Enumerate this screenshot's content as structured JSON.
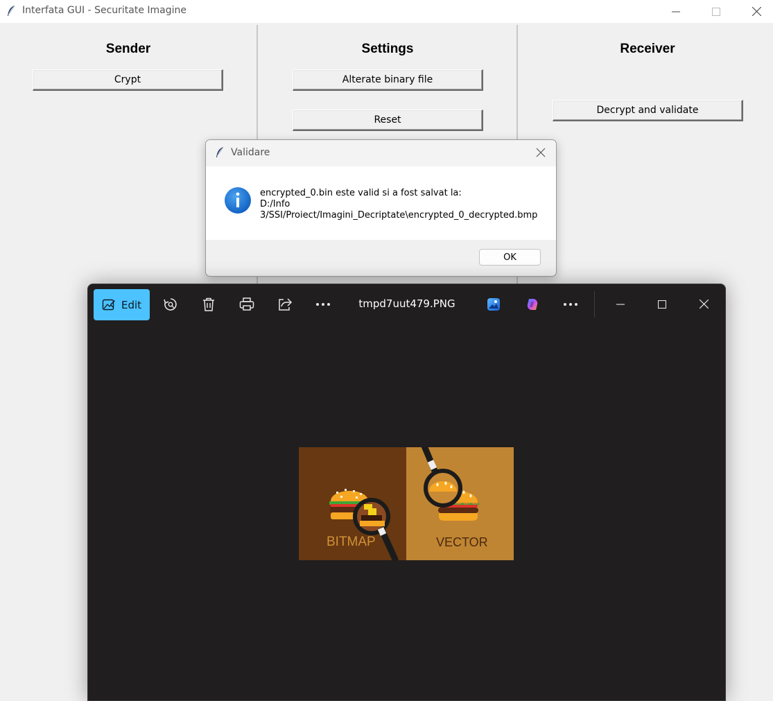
{
  "window": {
    "title": "Interfata GUI - Securitate Imagine"
  },
  "sender": {
    "title": "Sender",
    "crypt_label": "Crypt"
  },
  "settings": {
    "title": "Settings",
    "alterate_label": "Alterate binary file",
    "reset_label": "Reset"
  },
  "receiver": {
    "title": "Receiver",
    "decrypt_label": "Decrypt and validate"
  },
  "dialog": {
    "title": "Validare",
    "line1": "encrypted_0.bin este valid si a fost salvat la:",
    "line2": "D:/Info",
    "line3": "3/SSI/Proiect/Imagini_Decriptate\\encrypted_0_decrypted.bmp",
    "ok_label": "OK"
  },
  "photos": {
    "edit_label": "Edit",
    "filename": "tmpd7uut479.PNG",
    "image": {
      "left_label": "BITMAP",
      "right_label": "VECTOR"
    }
  },
  "colors": {
    "edit_accent": "#4cc2ff",
    "viewer_bg": "#201e1f",
    "info_blue": "#1a73d9"
  }
}
